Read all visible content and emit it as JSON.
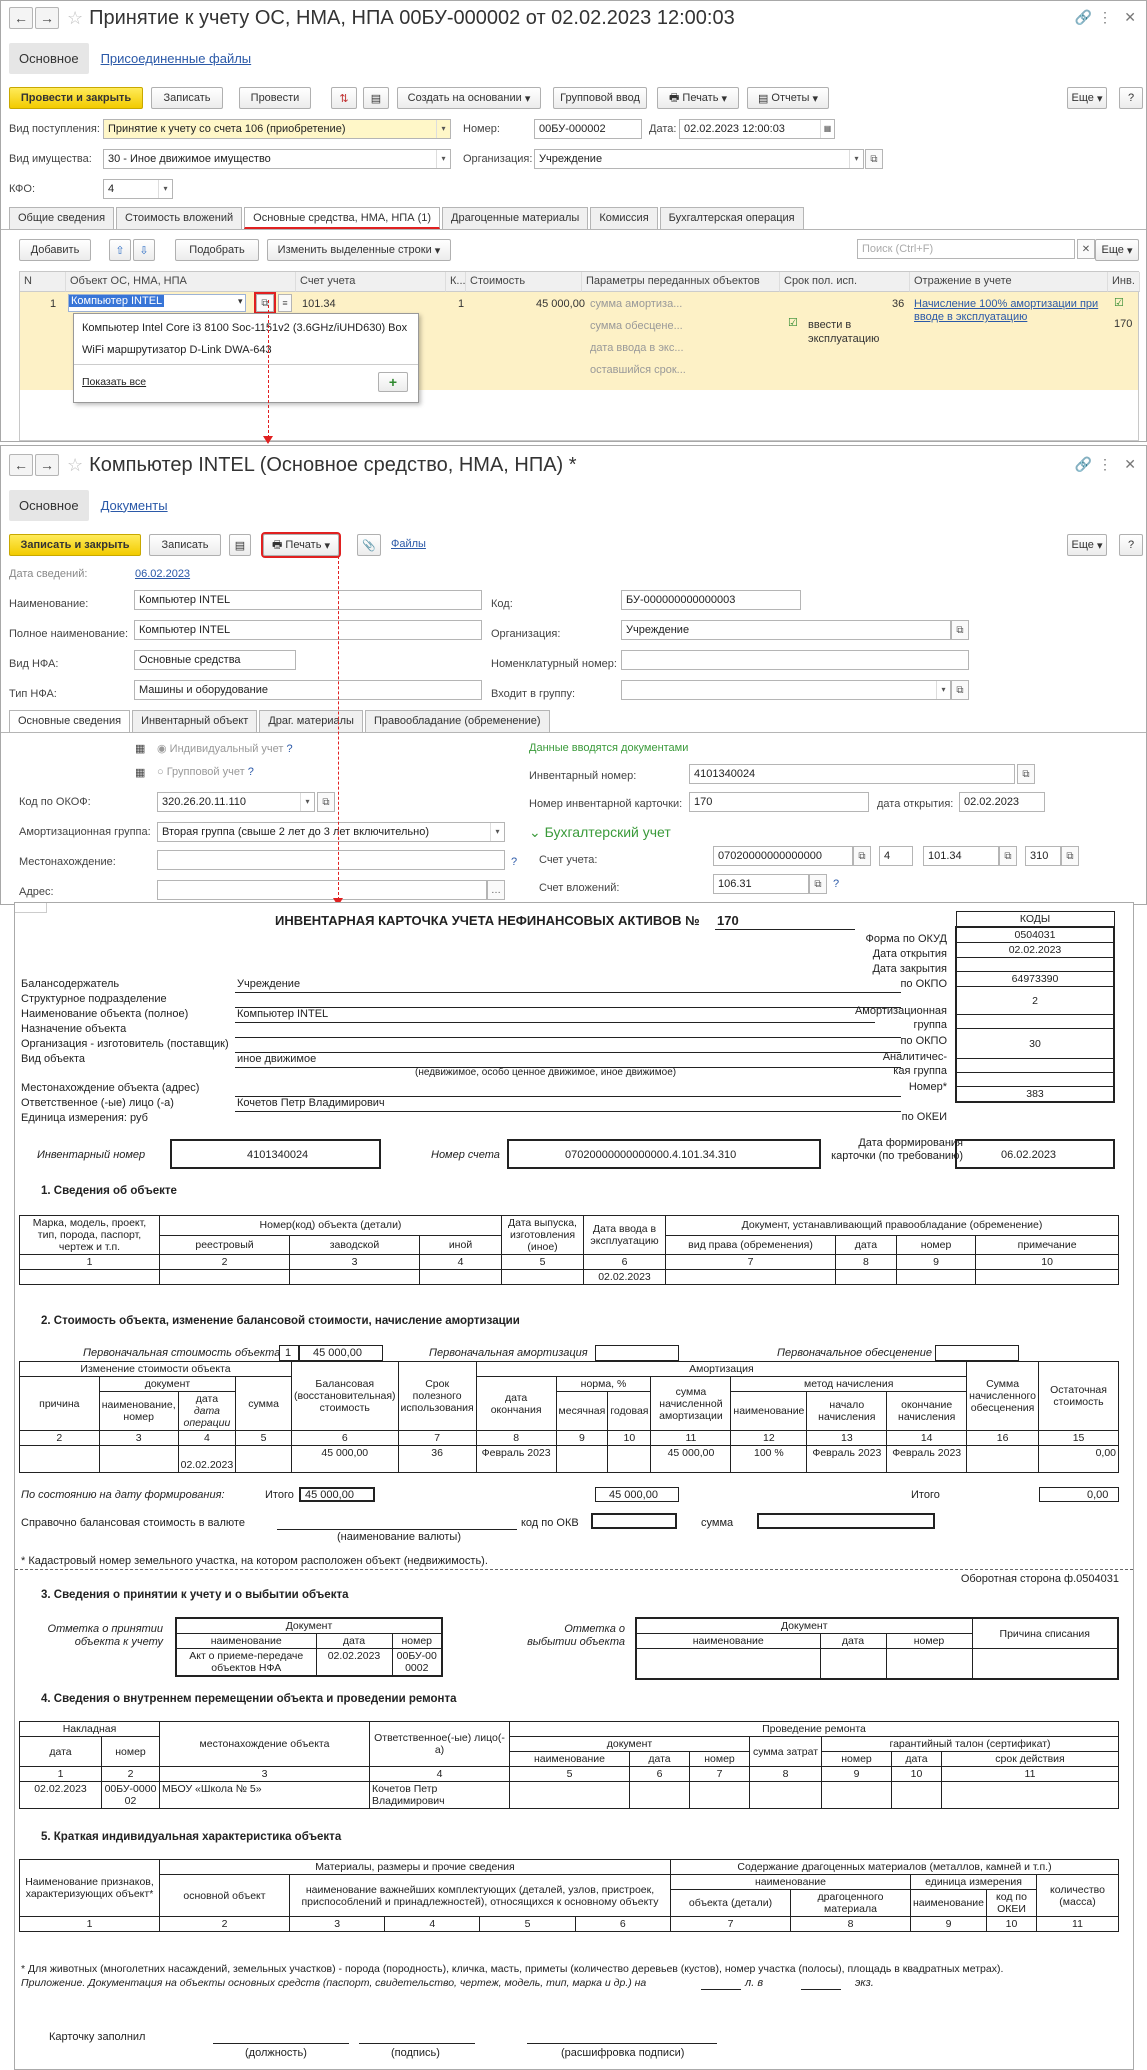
{
  "win1": {
    "title": "Принятие к учету ОС, НМА, НПА 00БУ-000002 от 02.02.2023 12:00:03",
    "tab_main": "Основное",
    "tab_files": "Присоединенные файлы",
    "toolbar": {
      "post_close": "Провести и закрыть",
      "save": "Записать",
      "post": "Провести",
      "create_based": "Создать на основании",
      "group_input": "Групповой ввод",
      "print": "Печать",
      "reports": "Отчеты",
      "more": "Еще",
      "help": "?"
    },
    "receipt_label": "Вид поступления:",
    "receipt_value": "Принятие к учету со счета 106 (приобретение)",
    "number_label": "Номер:",
    "number_value": "00БУ-000002",
    "date_label": "Дата:",
    "date_value": "02.02.2023 12:00:03",
    "property_label": "Вид имущества:",
    "property_value": "30 - Иное движимое имущество",
    "org_label": "Организация:",
    "org_value": "Учреждение",
    "kfo_label": "КФО:",
    "kfo_value": "4",
    "tabs": [
      "Общие сведения",
      "Стоимость вложений",
      "Основные средства, НМА, НПА (1)",
      "Драгоценные материалы",
      "Комиссия",
      "Бухгалтерская операция"
    ],
    "grid_toolbar": {
      "add": "Добавить",
      "pick": "Подобрать",
      "change_selected": "Изменить выделенные строки",
      "search_placeholder": "Поиск (Ctrl+F)",
      "more": "Еще"
    },
    "columns": [
      "N",
      "Объект ОС, НМА, НПА",
      "Счет учета",
      "К...",
      "Стоимость",
      "Параметры переданных объектов",
      "Срок пол. исп.",
      "Отражение в учете",
      "Инв."
    ],
    "row": {
      "n": "1",
      "object": "Компьютер INTEL",
      "account": "101.34",
      "k": "1",
      "cost": "45 000,00",
      "param1": "сумма амортиза...",
      "param2": "сумма обесцене...",
      "param3": "дата ввода в экс...",
      "param4": "оставшийся срок...",
      "term": "36",
      "commission": "ввести в эксплуатацию",
      "reflection": "Начисление 100% амортизации при вводе в эксплуатацию",
      "inv": "170"
    },
    "popup": {
      "item1": "Компьютер Intel Core i3 8100 Soc-1151v2 (3.6GHz/iUHD630) Box",
      "item2": "WiFi маршрутизатор D-Link DWA-643",
      "show_all": "Показать все"
    }
  },
  "win2": {
    "title": "Компьютер INTEL (Основное средство, НМА, НПА) *",
    "tab_main": "Основное",
    "tab_docs": "Документы",
    "toolbar": {
      "save_close": "Записать и закрыть",
      "save": "Записать",
      "print": "Печать",
      "files": "Файлы",
      "more": "Еще",
      "help": "?"
    },
    "info_date_label": "Дата сведений:",
    "info_date": "06.02.2023",
    "name_label": "Наименование:",
    "name_value": "Компьютер INTEL",
    "code_label": "Код:",
    "code_value": "БУ-000000000000003",
    "fullname_label": "Полное наименование:",
    "fullname_value": "Компьютер INTEL",
    "org_label": "Организация:",
    "org_value": "Учреждение",
    "nfa_kind_label": "Вид НФА:",
    "nfa_kind_value": "Основные средства",
    "nomen_label": "Номенклатурный номер:",
    "nfa_type_label": "Тип НФА:",
    "nfa_type_value": "Машины и оборудование",
    "group_label": "Входит в группу:",
    "tabs": [
      "Основные сведения",
      "Инвентарный объект",
      "Драг. материалы",
      "Правообладание (обременение)"
    ],
    "individual": "Индивидуальный учет",
    "group_acc": "Групповой учет",
    "docs_note": "Данные вводятся документами",
    "inv_num_label": "Инвентарный номер:",
    "inv_num_value": "4101340024",
    "card_num_label": "Номер инвентарной карточки:",
    "card_num_value": "170",
    "open_date_label": "дата открытия:",
    "open_date_value": "02.02.2023",
    "acc_section": "Бухгалтерский учет",
    "acc_label": "Счет учета:",
    "acc_value": "07020000000000000",
    "acc_kfo": "4",
    "acc_sub": "101.34",
    "acc_kosgu": "310",
    "inv_acc_label": "Счет вложений:",
    "inv_acc_value": "106.31",
    "okof_label": "Код по ОКОФ:",
    "okof_value": "320.26.20.11.110",
    "amort_label": "Амортизационная группа:",
    "amort_value": "Вторая группа (свыше 2 лет до 3 лет включительно)",
    "location_label": "Местонахождение:",
    "address_label": "Адрес:"
  },
  "report": {
    "title": "ИНВЕНТАРНАЯ КАРТОЧКА УЧЕТА НЕФИНАНСОВЫХ АКТИВОВ  №",
    "card_no": "170",
    "codes": "КОДЫ",
    "okud_label": "Форма по ОКУД",
    "okud": "0504031",
    "open_label": "Дата открытия",
    "open": "02.02.2023",
    "close_label": "Дата закрытия",
    "okpo_label": "по ОКПО",
    "okpo": "64973390",
    "holder_label": "Балансодержатель",
    "holder": "Учреждение",
    "division_label": "Структурное подразделение",
    "objname_label": "Наименование объекта (полное)",
    "objname": "Компьютер INTEL",
    "amort_group_label": "Амортизационная",
    "amort_group_label2": "группа",
    "amort_group": "2",
    "purpose_label": "Назначение объекта",
    "maker_label": "Организация - изготовитель (поставщик)",
    "okpo2_label": "по ОКПО",
    "kind_label": "Вид объекта",
    "kind": "иное движимое",
    "kind_hint": "(недвижимое, особо ценное движимое, иное движимое)",
    "analyt_label": "Аналитичес-",
    "analyt_label2": "кая группа",
    "analyt": "30",
    "loc_label": "Местонахождение объекта (адрес)",
    "num_label": "Номер*",
    "resp_label": "Ответственное (-ые) лицо (-а)",
    "resp": "Кочетов Петр Владимирович",
    "unit_label": "Единица измерения: руб",
    "okei_label": "по ОКЕИ",
    "okei": "383",
    "inv_num_label": "Инвентарный номер",
    "inv_num": "4101340024",
    "acc_num_label": "Номер счета",
    "acc_num": "07020000000000000.4.101.34.310",
    "form_date_label": "Дата формирования карточки (по требованию)",
    "form_date": "06.02.2023",
    "s1": "1. Сведения об объекте",
    "s1_h": [
      "Марка, модель, проект, тип, порода, паспорт, чертеж и т.п.",
      "Номер(код) объекта (детали)",
      "реестровый",
      "заводской",
      "иной",
      "Дата выпуска, изготовления (иное)",
      "Дата ввода в эксплуатацию",
      "Документ, устанавливающий правообладание (обременение)",
      "вид права (обременения)",
      "дата",
      "номер",
      "примечание"
    ],
    "s1_nums": [
      "1",
      "2",
      "3",
      "4",
      "5",
      "6",
      "7",
      "8",
      "9",
      "10"
    ],
    "s1_date": "02.02.2023",
    "s2": "2. Стоимость объекта, изменение балансовой стоимости, начисление амортизации",
    "s2_init_label": "Первоначальная стоимость объекта",
    "s2_init_n": "1",
    "s2_init": "45 000,00",
    "s2_init_amort": "Первоначальная амортизация",
    "s2_init_imp": "Первоначальное обесценение",
    "s2_h": [
      "Изменение стоимости объекта",
      "причина",
      "документ",
      "наименование, номер",
      "дата",
      "дата операции",
      "сумма",
      "Балансовая (восстановительная) стоимость",
      "Срок полезного использования",
      "Амортизация",
      "дата окончания",
      "норма, %",
      "месячная",
      "годовая",
      "сумма начисленной амортизации",
      "метод начисления",
      "наименование",
      "начало начисления",
      "окончание начисления",
      "Сумма начисленного обесценения",
      "Остаточная стоимость"
    ],
    "s2_nums": [
      "2",
      "3",
      "4",
      "5",
      "6",
      "7",
      "8",
      "9",
      "10",
      "11",
      "12",
      "13",
      "14",
      "16",
      "15"
    ],
    "s2_row": {
      "date": "02.02.2023",
      "balance": "45 000,00",
      "term": "36",
      "end": "Февраль 2023",
      "amort": "45 000,00",
      "method": "100 %",
      "start": "Февраль 2023",
      "finish": "Февраль 2023",
      "resid": "0,00"
    },
    "s2_state": "По состоянию на дату формирования:",
    "s2_total": "Итого",
    "s2_total_bal": "45 000,00",
    "s2_total_amort": "45 000,00",
    "s2_total2": "Итого",
    "s2_resid": "0,00",
    "currency_label": "Справочно балансовая стоимость в валюте",
    "currency_hint": "(наименование валюты)",
    "okv_label": "код по ОКВ",
    "sum_label": "сумма",
    "cadastral": "* Кадастровый номер земельного участка, на котором расположен объект (недвижимость).",
    "reverse": "Оборотная сторона ф.0504031",
    "s3": "3. Сведения о принятии к учету и о выбытии объекта",
    "s3_accept": "Отметка о принятии объекта к учету",
    "s3_dispose": "Отметка о выбытии объекта",
    "s3_h": [
      "Документ",
      "наименование",
      "дата",
      "номер",
      "Причина списания"
    ],
    "s3_row": {
      "name": "Акт о приеме-передаче объектов НФА",
      "date": "02.02.2023",
      "num": "00БУ-000002"
    },
    "s4": "4. Сведения о внутреннем перемещении объекта и проведении ремонта",
    "s4_h": [
      "Накладная",
      "дата",
      "номер",
      "местонахождение объекта",
      "Ответственное(-ые) лицо(-а)",
      "Проведение ремонта",
      "документ",
      "наименование",
      "дата",
      "номер",
      "сумма затрат",
      "гарантийный талон (сертификат)",
      "номер",
      "дата",
      "срок действия"
    ],
    "s4_nums": [
      "1",
      "2",
      "3",
      "4",
      "5",
      "6",
      "7",
      "8",
      "9",
      "10",
      "11"
    ],
    "s4_row": {
      "date": "02.02.2023",
      "num": "00БУ-000002",
      "loc": "МБОУ «Школа № 5»",
      "resp": "Кочетов Петр Владимирович"
    },
    "s5": "5. Краткая индивидуальная характеристика объекта",
    "s5_h": [
      "Наименование признаков, характеризующих объект*",
      "Материалы, размеры и прочие сведения",
      "основной объект",
      "наименование важнейших комплектующих (деталей, узлов, пристроек, приспособлений и принадлежностей), относящихся к основному объекту",
      "Содержание драгоценных материалов (металлов, камней и т.п.)",
      "наименование",
      "объекта (детали)",
      "драгоценного материала",
      "единица измерения",
      "наименование",
      "код по ОКЕИ",
      "количество (масса)"
    ],
    "s5_nums": [
      "1",
      "2",
      "3",
      "4",
      "5",
      "6",
      "7",
      "8",
      "9",
      "10",
      "11"
    ],
    "foot1": "* Для животных (многолетних насаждений, земельных участков) - порода (породность), кличка, масть, приметы (количество деревьев (кустов), номер участка (полосы), площадь в квадратных метрах).",
    "foot2": "Приложение. Документация на объекты основных средств (паспорт, свидетельство, чертеж, модель, тип, марка и др.) на",
    "foot2_l": "л. в",
    "foot2_e": "экз.",
    "filled": "Карточку заполнил",
    "sig1": "(должность)",
    "sig2": "(подпись)",
    "sig3": "(расшифровка подписи)"
  }
}
